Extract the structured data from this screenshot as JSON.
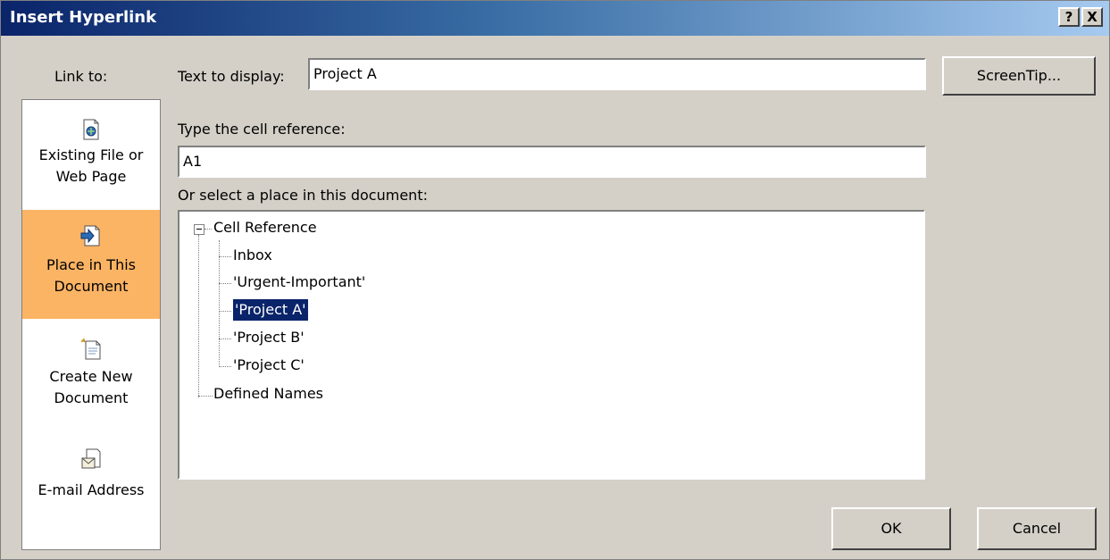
{
  "window": {
    "title": "Insert Hyperlink",
    "help_label": "?",
    "close_label": "X"
  },
  "link_to": {
    "label": "Link to:",
    "items": [
      {
        "line1": "Existing File or",
        "line2": "Web Page",
        "icon": "existing-file-icon",
        "selected": false
      },
      {
        "line1": "Place in This",
        "line2": "Document",
        "icon": "place-in-document-icon",
        "selected": true
      },
      {
        "line1": "Create New",
        "line2": "Document",
        "icon": "create-new-document-icon",
        "selected": false
      },
      {
        "line1": "E-mail Address",
        "line2": "",
        "icon": "email-address-icon",
        "selected": false
      }
    ],
    "selected_color": "#fbb464"
  },
  "text_to_display": {
    "label": "Text to display:",
    "value": "Project A"
  },
  "screentip_button": "ScreenTip...",
  "cell_reference": {
    "label": "Type the cell reference:",
    "value": "A1"
  },
  "place_select": {
    "label": "Or select a place in this document:",
    "root": "Cell Reference",
    "children": [
      "Inbox",
      "'Urgent-Important'",
      "'Project A'",
      "'Project B'",
      "'Project C'"
    ],
    "selected": "'Project A'",
    "other": "Defined Names"
  },
  "buttons": {
    "ok": "OK",
    "cancel": "Cancel"
  },
  "colors": {
    "title_gradient_start": "#0a246a",
    "dialog_bg": "#d4d0c8",
    "selection_bg": "#0a246a"
  }
}
